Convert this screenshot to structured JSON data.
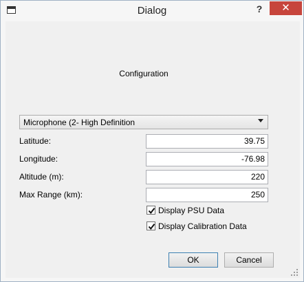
{
  "window": {
    "title": "Dialog",
    "help_label": "?",
    "close_label": "✕"
  },
  "config": {
    "heading": "Configuration"
  },
  "device": {
    "selected": "Microphone (2- High Definition"
  },
  "fields": {
    "latitude": {
      "label": "Latitude:",
      "value": "39.75"
    },
    "longitude": {
      "label": "Longitude:",
      "value": "-76.98"
    },
    "altitude": {
      "label": "Altitude (m):",
      "value": "220"
    },
    "max_range": {
      "label": "Max Range (km):",
      "value": "250"
    }
  },
  "options": {
    "psu": {
      "label": "Display PSU Data",
      "checked": true
    },
    "calibration": {
      "label": "Display Calibration Data",
      "checked": true
    }
  },
  "buttons": {
    "ok": "OK",
    "cancel": "Cancel"
  }
}
